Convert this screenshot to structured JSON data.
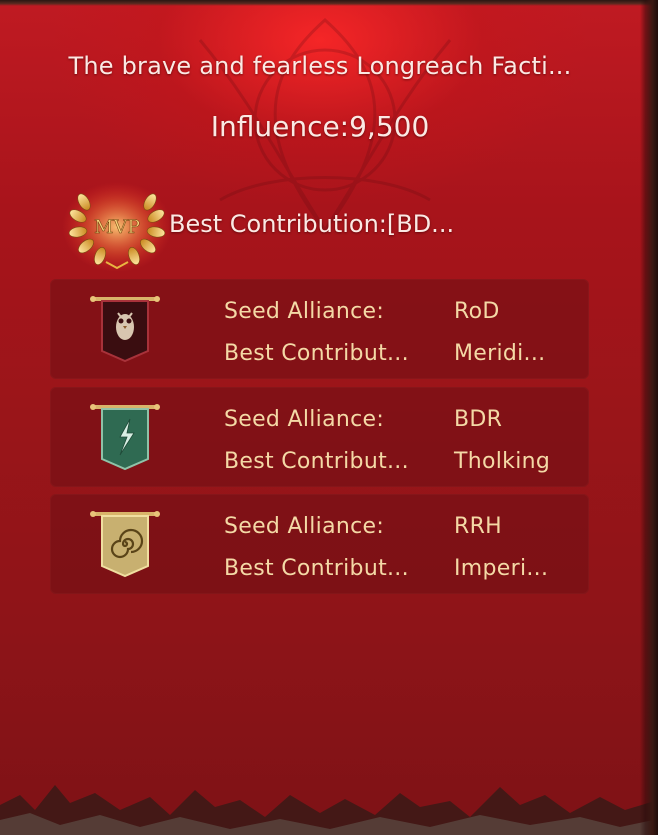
{
  "header": {
    "title": "The brave and fearless Longreach Facti...",
    "influence_text": "Influence:9,500"
  },
  "mvp": {
    "badge_text": "MVP",
    "best_contribution_text": "Best Contribution:[BD..."
  },
  "alliances": [
    {
      "banner_icon": "owl-banner-icon",
      "seed_label": "Seed Alliance:",
      "seed_value": "RoD",
      "contrib_label": "Best Contribut...",
      "contrib_value": "Meridi..."
    },
    {
      "banner_icon": "lightning-banner-icon",
      "seed_label": "Seed Alliance:",
      "seed_value": "BDR",
      "contrib_label": "Best Contribut...",
      "contrib_value": "Tholking"
    },
    {
      "banner_icon": "spiral-banner-icon",
      "seed_label": "Seed Alliance:",
      "seed_value": "RRH",
      "contrib_label": "Best Contribut...",
      "contrib_value": "Imperi..."
    }
  ],
  "colors": {
    "panel_red": "#a8141b",
    "title_text": "#fbe9e4",
    "card_text": "#f4d9a6",
    "gold": "#e9b441"
  }
}
